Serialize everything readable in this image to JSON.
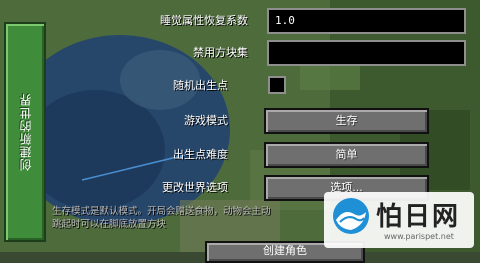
{
  "sidebar": {
    "tab_label": "创建新的世界"
  },
  "settings": {
    "sleep_recovery": {
      "label": "睡觉属性恢复系数",
      "value": "1.0"
    },
    "banned_blocks": {
      "label": "禁用方块集",
      "value": ""
    },
    "random_spawn": {
      "label": "随机出生点",
      "checked": false
    },
    "game_mode": {
      "label": "游戏模式",
      "value": "生存"
    },
    "spawn_difficulty": {
      "label": "出生点难度",
      "value": "简单"
    },
    "world_options": {
      "label": "更改世界选项",
      "value": "选项..."
    }
  },
  "help_text": {
    "line1": "生存模式是默认模式。开局会赠送食物，动物会主动",
    "line2": "跳起时可以在脚底放置方块"
  },
  "footer": {
    "create_button": "创建角色"
  },
  "watermark": {
    "brand": "怕日网",
    "url": "www.parispet.net"
  },
  "colors": {
    "tab_green": "#3f8d3a",
    "button_gray": "#6f6f6f",
    "field_bg": "#000000"
  }
}
